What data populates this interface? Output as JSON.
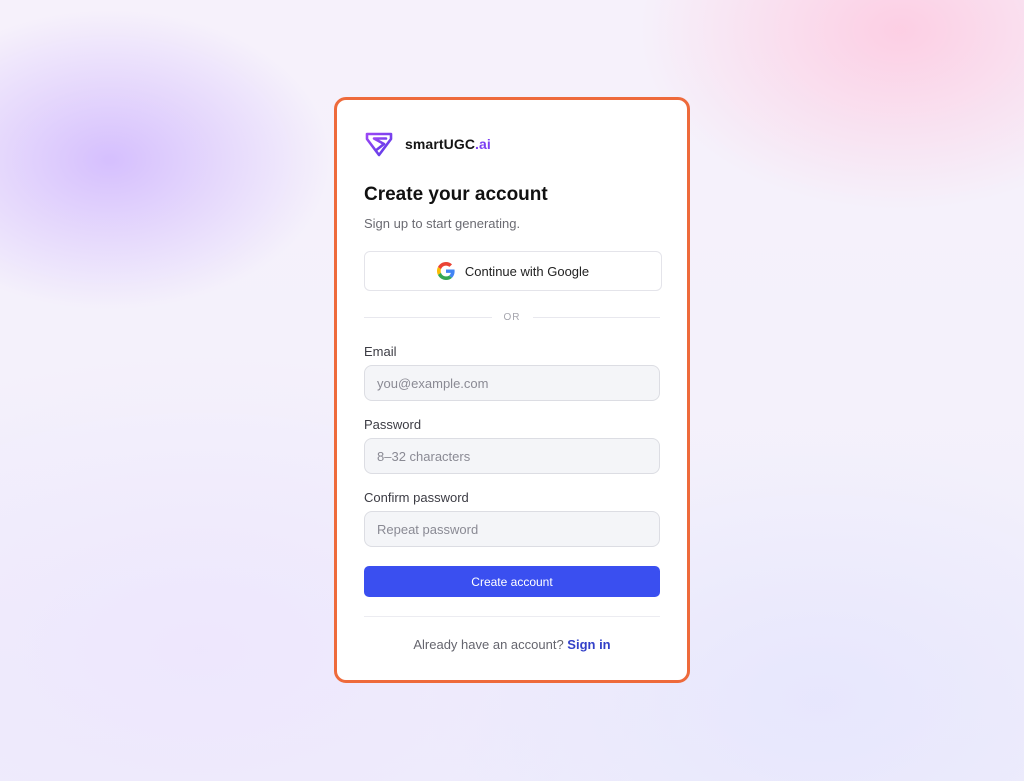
{
  "brand": {
    "name": "smartUGC",
    "tld": ".ai",
    "logo_icon": "shield-s-logo-icon"
  },
  "heading": {
    "title": "Create your account",
    "subtitle": "Sign up to start generating."
  },
  "google_button": {
    "label": "Continue with Google",
    "icon": "google-g-icon"
  },
  "divider": {
    "label": "OR"
  },
  "form": {
    "email": {
      "label": "Email",
      "value": "",
      "placeholder": "you@example.com"
    },
    "password": {
      "label": "Password",
      "value": "",
      "placeholder": "8–32 characters"
    },
    "confirm_password": {
      "label": "Confirm password",
      "value": "",
      "placeholder": "Repeat password"
    },
    "submit_label": "Create account"
  },
  "footer": {
    "prompt": "Already have an account?",
    "link_label": "Sign in"
  },
  "colors": {
    "accent": "#3a4ff0",
    "card_border": "#ee6a3b",
    "brand_purple": "#7b3ff2",
    "link": "#3340c8"
  }
}
